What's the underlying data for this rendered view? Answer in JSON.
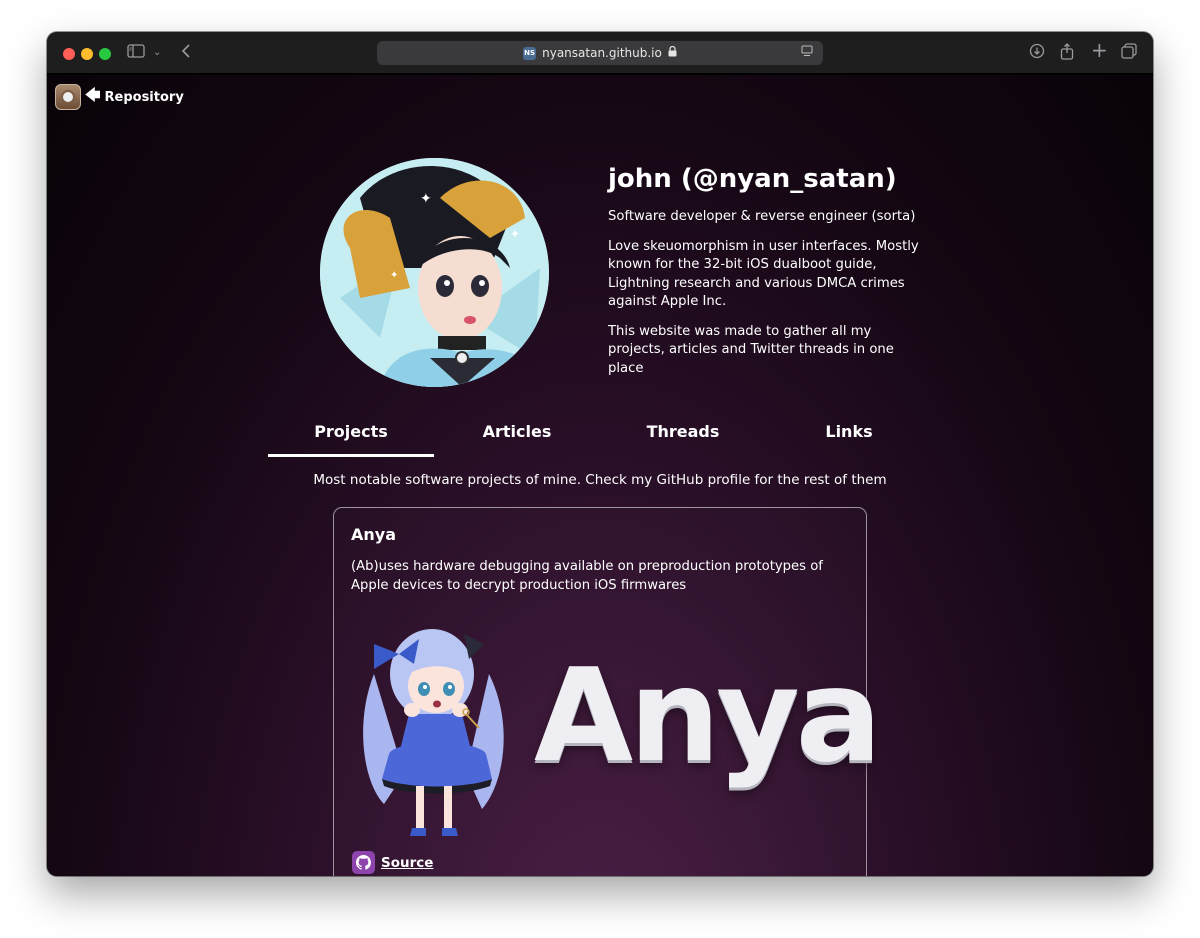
{
  "browser": {
    "url": "nyansatan.github.io",
    "favicon_text": "NS"
  },
  "nav": {
    "repository_label": "Repository"
  },
  "profile": {
    "name": "john (@nyan_satan)",
    "tagline": "Software developer & reverse engineer (sorta)",
    "bio": "Love skeuomorphism in user interfaces. Mostly known for the 32-bit iOS dualboot guide, Lightning research and various DMCA crimes against Apple Inc.",
    "about": "This website was made to gather all my projects, articles and Twitter threads in one place"
  },
  "tabs": [
    {
      "label": "Projects",
      "active": true
    },
    {
      "label": "Articles",
      "active": false
    },
    {
      "label": "Threads",
      "active": false
    },
    {
      "label": "Links",
      "active": false
    }
  ],
  "projects_intro": "Most notable software projects of mine. Check my GitHub profile for the rest of them",
  "project": {
    "title": "Anya",
    "description": "(Ab)uses hardware debugging available on preproduction prototypes of Apple devices to decrypt production iOS firmwares",
    "banner_text": "Anya",
    "source_label": "Source"
  },
  "colors": {
    "background_center": "#4a1d45",
    "background_edge": "#090309",
    "text": "#ffffff",
    "github_badge": "#8e44ad"
  }
}
